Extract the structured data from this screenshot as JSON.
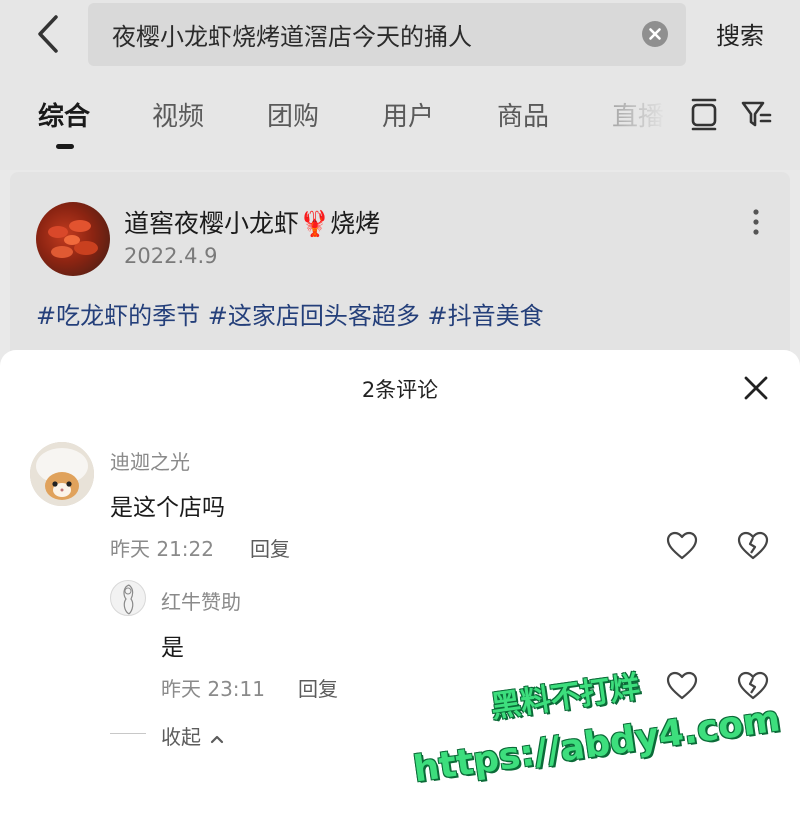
{
  "header": {
    "search_query": "夜樱小龙虾烧烤道滘店今天的捅人",
    "search_button": "搜索"
  },
  "tabs": [
    {
      "label": "综合",
      "active": true
    },
    {
      "label": "视频"
    },
    {
      "label": "团购"
    },
    {
      "label": "用户"
    },
    {
      "label": "商品"
    },
    {
      "label": "直播"
    }
  ],
  "post": {
    "title": "道窖夜樱小龙虾🦞烧烤",
    "date": "2022.4.9",
    "hashtags": "#吃龙虾的季节 #这家店回头客超多 #抖音美食"
  },
  "comments_sheet": {
    "title": "2条评论",
    "comments": [
      {
        "user": "迪迦之光",
        "text": "是这个店吗",
        "time": "昨天 21:22",
        "reply_label": "回复",
        "replies": [
          {
            "user": "红牛赞助",
            "text": "是",
            "time": "昨天 23:11",
            "reply_label": "回复"
          }
        ]
      }
    ],
    "collapse_label": "收起"
  },
  "watermark": {
    "line1": "黑料不打烊",
    "line2": "https://abdy4.com"
  },
  "colors": {
    "hashtag": "#243f7a",
    "watermark": "#3dde7d",
    "sheet_bg": "#ffffff",
    "page_bg": "#e9e9e9"
  }
}
